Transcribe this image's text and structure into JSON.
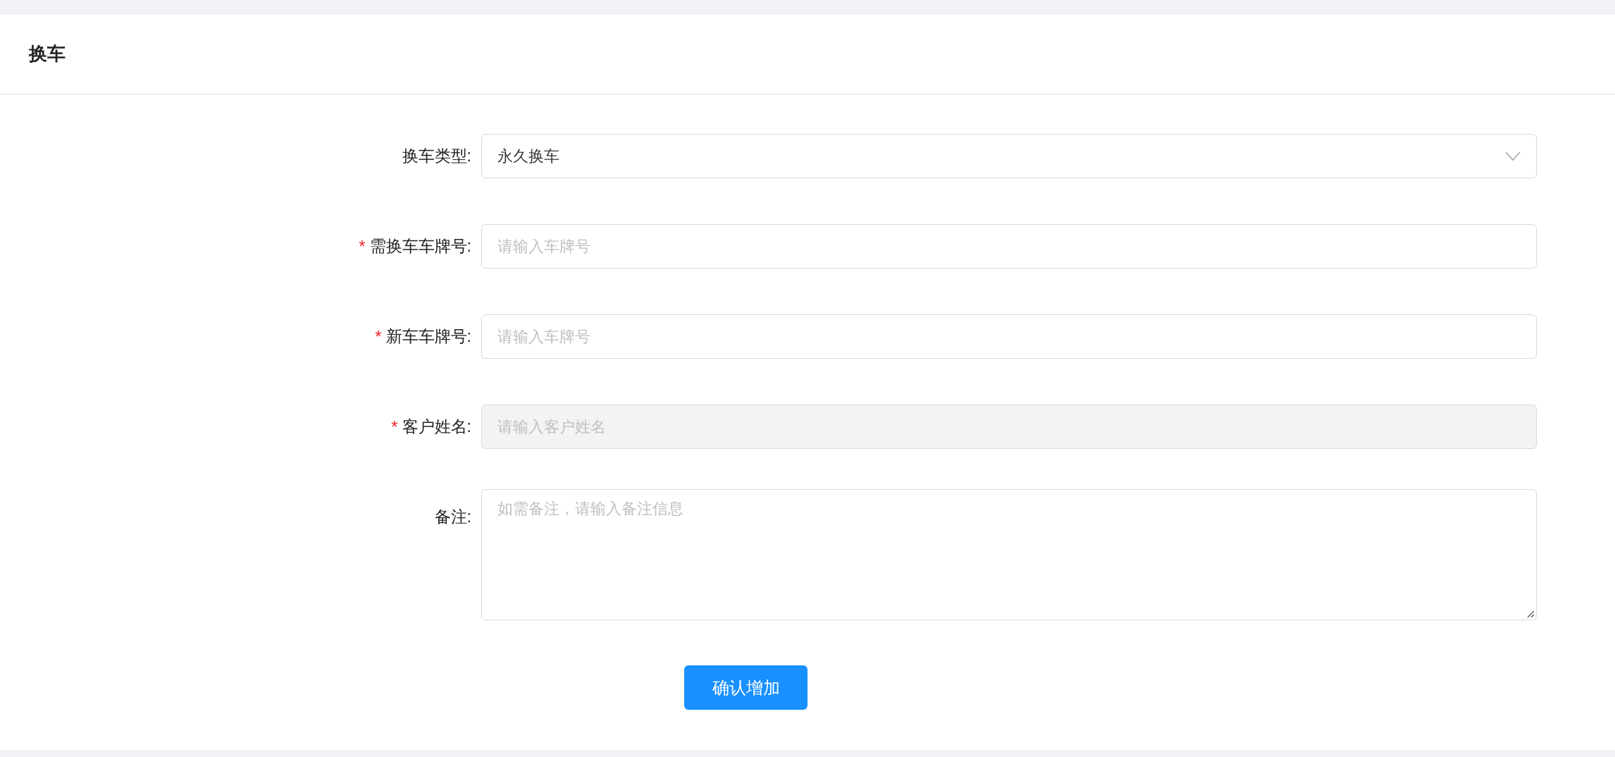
{
  "header": {
    "title": "换车"
  },
  "fields": [
    {
      "kind": "select",
      "label": "换车类型:",
      "value": "永久换车"
    },
    {
      "kind": "input",
      "required_mark": "*",
      "label": "需换车车牌号:",
      "placeholder": "请输入车牌号",
      "disabled": false
    },
    {
      "kind": "input",
      "required_mark": "*",
      "label": "新车车牌号:",
      "placeholder": "请输入车牌号",
      "disabled": false
    },
    {
      "kind": "input",
      "required_mark": "*",
      "label": "客户姓名:",
      "placeholder": "请输入客户姓名",
      "disabled": true
    },
    {
      "kind": "textarea",
      "label": "备注:",
      "placeholder": "如需备注，请输入备注信息"
    }
  ],
  "submit": "确认增加"
}
